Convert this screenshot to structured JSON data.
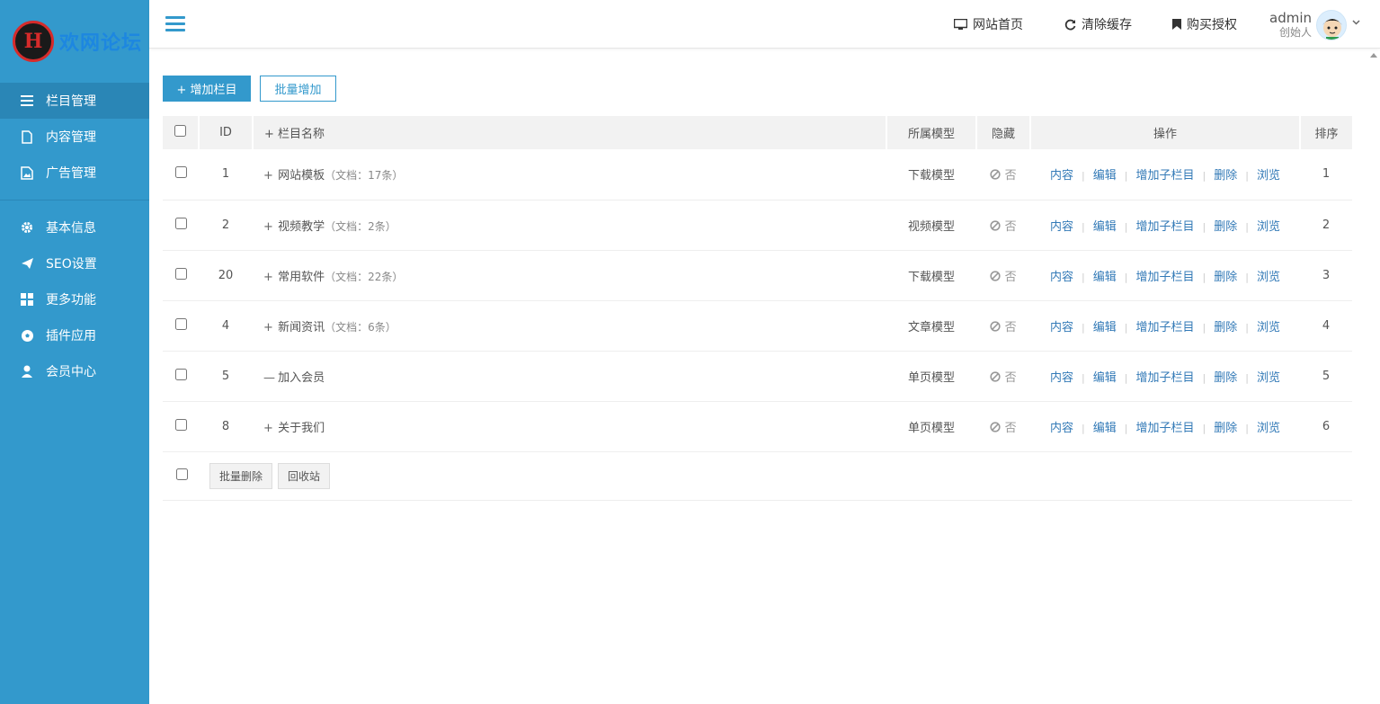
{
  "sidebar": {
    "logo_text": "欢网论坛",
    "items": [
      {
        "label": "栏目管理",
        "icon": "list-icon",
        "active": true
      },
      {
        "label": "内容管理",
        "icon": "file-icon"
      },
      {
        "label": "广告管理",
        "icon": "image-icon"
      },
      {
        "label": "基本信息",
        "icon": "gear-icon"
      },
      {
        "label": "SEO设置",
        "icon": "paper-plane-icon"
      },
      {
        "label": "更多功能",
        "icon": "grid-icon"
      },
      {
        "label": "插件应用",
        "icon": "soccer-ball-icon"
      },
      {
        "label": "会员中心",
        "icon": "user-icon"
      }
    ]
  },
  "topbar": {
    "home_label": "网站首页",
    "clear_cache_label": "清除缓存",
    "buy_license_label": "购买授权",
    "username": "admin",
    "user_role": "创始人"
  },
  "toolbar": {
    "add_label": "+ 增加栏目",
    "batch_add_label": "批量增加"
  },
  "table": {
    "headers": {
      "id": "ID",
      "name": "+ 栏目名称",
      "model": "所属模型",
      "hidden": "隐藏",
      "ops": "操作",
      "sort": "排序"
    },
    "ops_labels": [
      "内容",
      "编辑",
      "增加子栏目",
      "删除",
      "浏览"
    ],
    "rows": [
      {
        "id": "1",
        "sign": "+",
        "name": "网站模板",
        "count": "（文档：17条）",
        "model": "下载模型",
        "hidden": "否",
        "sort": "1"
      },
      {
        "id": "2",
        "sign": "+",
        "name": "视频教学",
        "count": "（文档：2条）",
        "model": "视频模型",
        "hidden": "否",
        "sort": "2"
      },
      {
        "id": "20",
        "sign": "+",
        "name": "常用软件",
        "count": "（文档：22条）",
        "model": "下载模型",
        "hidden": "否",
        "sort": "3"
      },
      {
        "id": "4",
        "sign": "+",
        "name": "新闻资讯",
        "count": "（文档：6条）",
        "model": "文章模型",
        "hidden": "否",
        "sort": "4"
      },
      {
        "id": "5",
        "sign": "—",
        "name": "加入会员",
        "count": "",
        "model": "单页模型",
        "hidden": "否",
        "sort": "5"
      },
      {
        "id": "8",
        "sign": "+",
        "name": "关于我们",
        "count": "",
        "model": "单页模型",
        "hidden": "否",
        "sort": "6"
      }
    ]
  },
  "footer": {
    "batch_delete_label": "批量删除",
    "recycle_label": "回收站"
  },
  "colors": {
    "accent": "#3399cc",
    "link": "#337ab7"
  }
}
